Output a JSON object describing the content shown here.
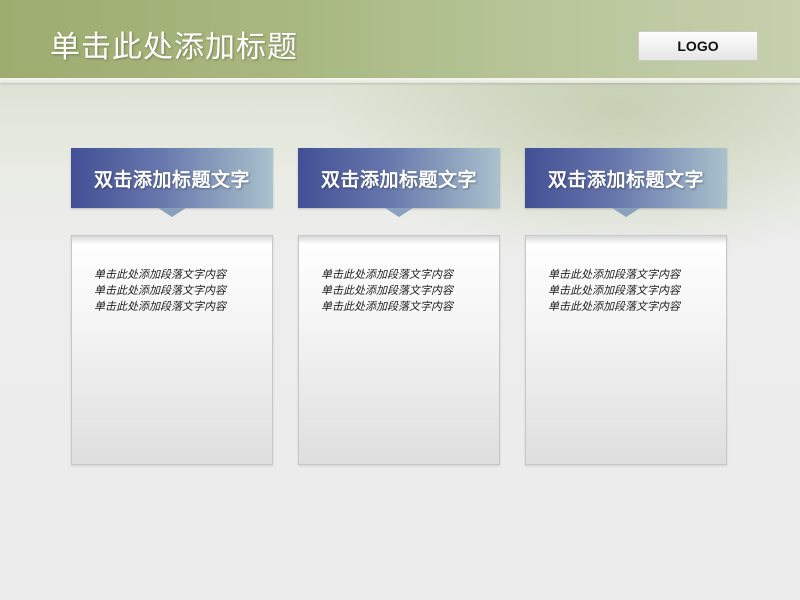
{
  "slide": {
    "title": "单击此处添加标题",
    "logo": "LOGO"
  },
  "columns": [
    {
      "heading": "双击添加标题文字",
      "body_lines": [
        "单击此处添加段落文字内容",
        "单击此处添加段落文字内容",
        "单击此处添加段落文字内容"
      ]
    },
    {
      "heading": "双击添加标题文字",
      "body_lines": [
        "单击此处添加段落文字内容",
        "单击此处添加段落文字内容",
        "单击此处添加段落文字内容"
      ]
    },
    {
      "heading": "双击添加标题文字",
      "body_lines": [
        "单击此处添加段落文字内容",
        "单击此处添加段落文字内容",
        "单击此处添加段落文字内容"
      ]
    }
  ],
  "colors": {
    "header_green": "#a7b77e",
    "heading_blue": "#434f96",
    "heading_teal": "#a9c2cc"
  }
}
